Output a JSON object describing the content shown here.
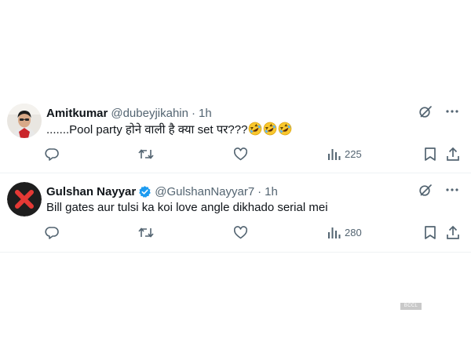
{
  "tweets": [
    {
      "display_name": "Amitkumar",
      "handle": "@dubeyjikahin",
      "separator": "·",
      "time": "1h",
      "text": ".......Pool party होने वाली है क्या set पर???",
      "emoji_count": 3,
      "emoji": "rolling-on-floor-laughing",
      "verified": false,
      "views": "225",
      "avatar": "person-photo"
    },
    {
      "display_name": "Gulshan Nayyar",
      "handle": "@GulshanNayyar7",
      "separator": "·",
      "time": "1h",
      "text": "Bill gates aur tulsi ka koi love angle dikhado serial mei",
      "verified": true,
      "views": "280",
      "avatar": "red-x-mark"
    }
  ],
  "icons": [
    "grok-icon",
    "more-icon",
    "reply-icon",
    "retweet-icon",
    "like-icon",
    "views-icon",
    "bookmark-icon",
    "share-icon"
  ],
  "colors": {
    "text": "#0f1419",
    "secondary": "#536471",
    "verified": "#1d9bf0",
    "divider": "#eff3f4"
  },
  "watermark": "BCCL"
}
